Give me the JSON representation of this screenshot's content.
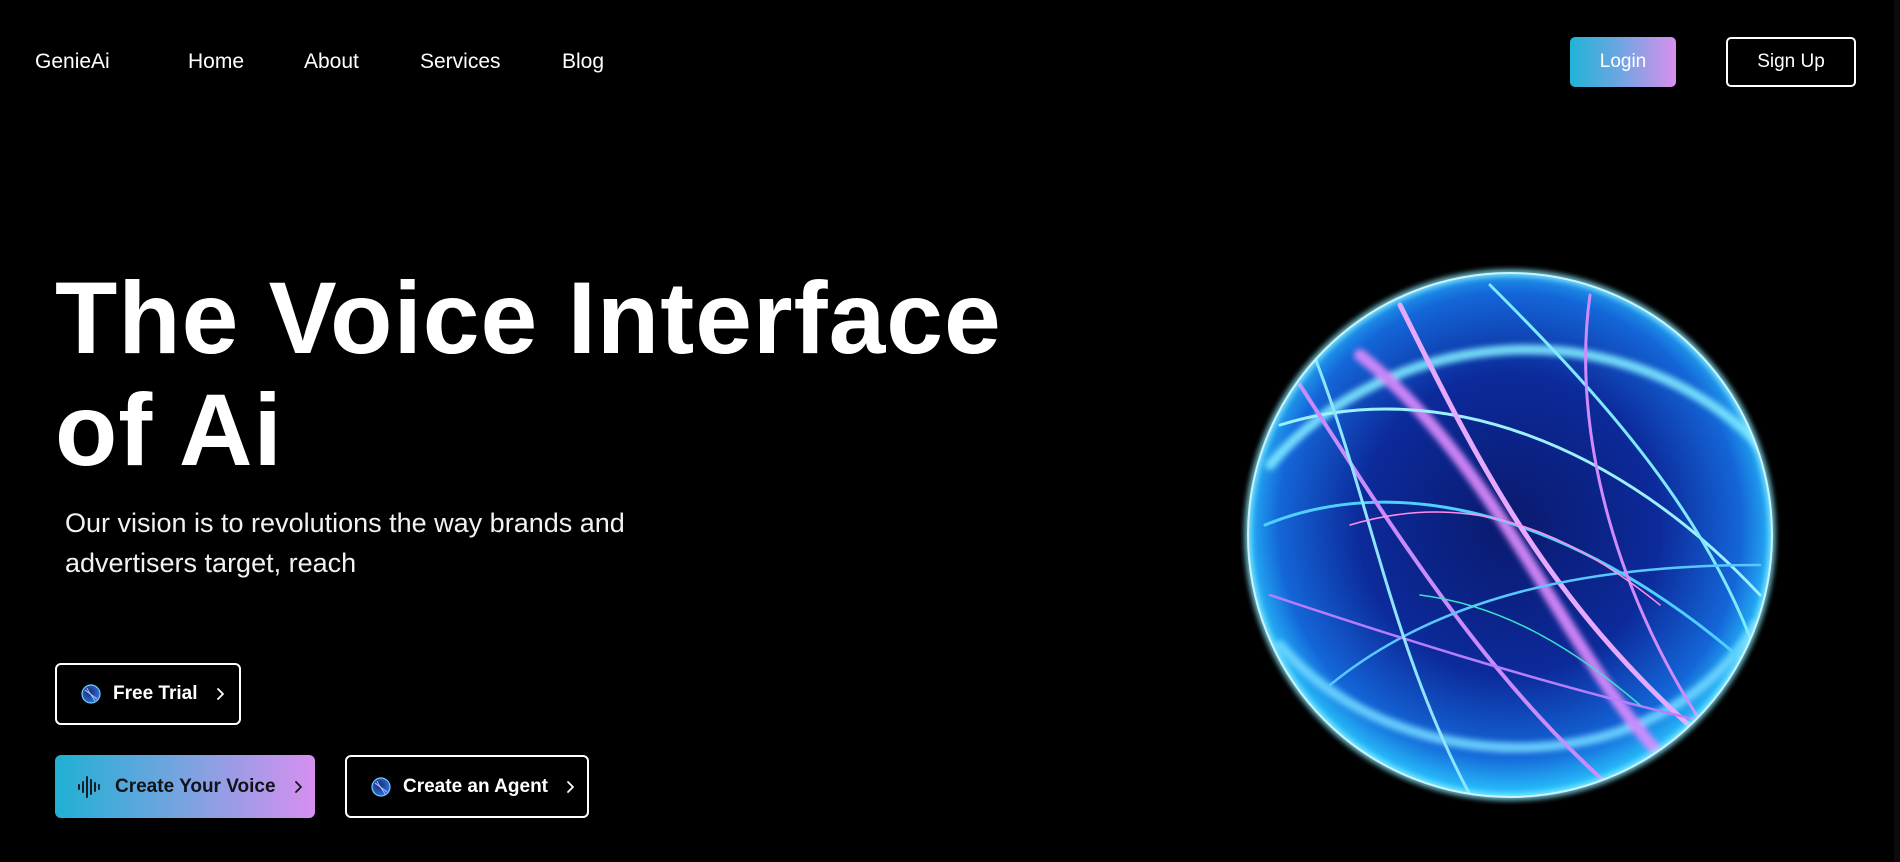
{
  "header": {
    "logo": "GenieAi",
    "nav": [
      {
        "label": "Home"
      },
      {
        "label": "About"
      },
      {
        "label": "Services"
      },
      {
        "label": "Blog"
      }
    ],
    "login_label": "Login",
    "signup_label": "Sign Up"
  },
  "hero": {
    "title_line1": "The Voice Interface",
    "title_line2": "of Ai",
    "subtitle_line1": "Our vision is to revolutions the way brands and",
    "subtitle_line2": "advertisers target, reach",
    "free_trial_label": "Free Trial",
    "create_voice_label": "Create Your Voice",
    "create_agent_label": "Create an Agent"
  },
  "icons": {
    "button_icon": "globe-icon",
    "voice_icon": "sound-wave-icon",
    "arrow_icon": "chevron-right-icon",
    "hero_visual": "glowing-orb-illustration"
  },
  "colors": {
    "background": "#000000",
    "gradient_start": "#21b3d6",
    "gradient_end": "#d990ee",
    "text": "#ffffff"
  }
}
